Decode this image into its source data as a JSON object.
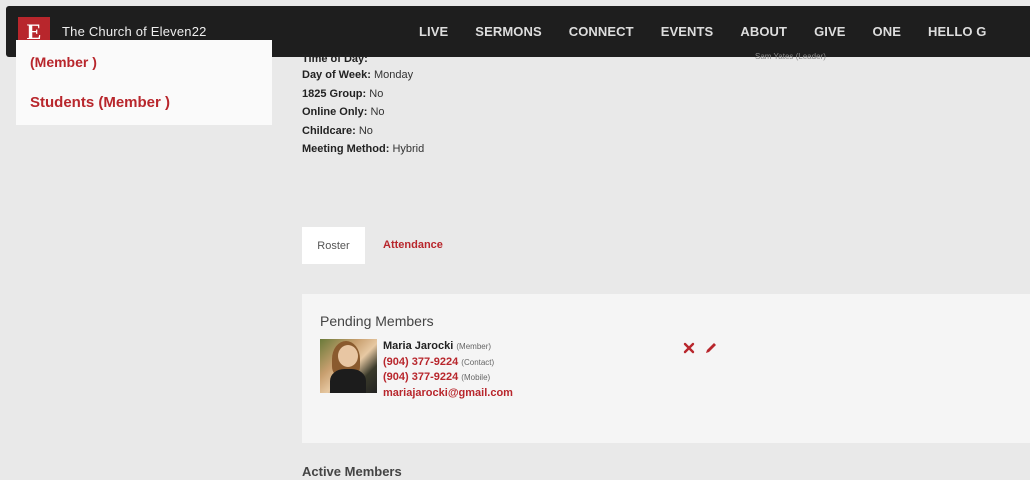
{
  "header": {
    "logo_letter": "E",
    "brand": "The Church of Eleven22",
    "nav": [
      "LIVE",
      "SERMONS",
      "CONNECT",
      "EVENTS",
      "ABOUT",
      "GIVE",
      "ONE",
      "HELLO G"
    ]
  },
  "sidebar": {
    "partial_item": "(Member )",
    "item": "Students (Member )"
  },
  "details": {
    "partial": "Time of Day:",
    "fields": [
      {
        "label": "Day of Week:",
        "value": "Monday"
      },
      {
        "label": "1825 Group:",
        "value": "No"
      },
      {
        "label": "Online Only:",
        "value": "No"
      },
      {
        "label": "Childcare:",
        "value": "No"
      },
      {
        "label": "Meeting Method:",
        "value": "Hybrid"
      }
    ],
    "right_partial": "Sam Yates (Leader)"
  },
  "tabs": {
    "roster": "Roster",
    "attendance": "Attendance"
  },
  "pending": {
    "title": "Pending Members",
    "member": {
      "name": "Maria Jarocki",
      "role": "(Member)",
      "phone_contact": "(904) 377-9224",
      "phone_contact_tag": "(Contact)",
      "phone_mobile": "(904) 377-9224",
      "phone_mobile_tag": "(Mobile)",
      "email": "mariajarocki@gmail.com"
    }
  },
  "active": {
    "title": "Active Members"
  },
  "colors": {
    "accent": "#b8262c",
    "nav_bg": "#1e1e1e",
    "page_bg": "#e9e9e9"
  },
  "icons": {
    "remove": "close-icon",
    "edit": "pencil-icon"
  }
}
